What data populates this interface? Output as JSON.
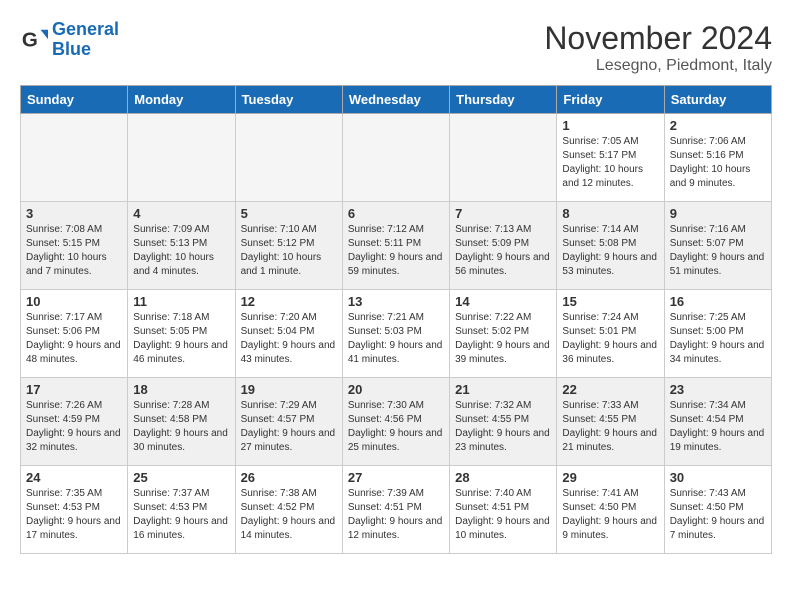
{
  "logo": {
    "line1": "General",
    "line2": "Blue"
  },
  "title": "November 2024",
  "subtitle": "Lesegno, Piedmont, Italy",
  "days_of_week": [
    "Sunday",
    "Monday",
    "Tuesday",
    "Wednesday",
    "Thursday",
    "Friday",
    "Saturday"
  ],
  "weeks": [
    [
      {
        "day": "",
        "info": ""
      },
      {
        "day": "",
        "info": ""
      },
      {
        "day": "",
        "info": ""
      },
      {
        "day": "",
        "info": ""
      },
      {
        "day": "",
        "info": ""
      },
      {
        "day": "1",
        "info": "Sunrise: 7:05 AM\nSunset: 5:17 PM\nDaylight: 10 hours and 12 minutes."
      },
      {
        "day": "2",
        "info": "Sunrise: 7:06 AM\nSunset: 5:16 PM\nDaylight: 10 hours and 9 minutes."
      }
    ],
    [
      {
        "day": "3",
        "info": "Sunrise: 7:08 AM\nSunset: 5:15 PM\nDaylight: 10 hours and 7 minutes."
      },
      {
        "day": "4",
        "info": "Sunrise: 7:09 AM\nSunset: 5:13 PM\nDaylight: 10 hours and 4 minutes."
      },
      {
        "day": "5",
        "info": "Sunrise: 7:10 AM\nSunset: 5:12 PM\nDaylight: 10 hours and 1 minute."
      },
      {
        "day": "6",
        "info": "Sunrise: 7:12 AM\nSunset: 5:11 PM\nDaylight: 9 hours and 59 minutes."
      },
      {
        "day": "7",
        "info": "Sunrise: 7:13 AM\nSunset: 5:09 PM\nDaylight: 9 hours and 56 minutes."
      },
      {
        "day": "8",
        "info": "Sunrise: 7:14 AM\nSunset: 5:08 PM\nDaylight: 9 hours and 53 minutes."
      },
      {
        "day": "9",
        "info": "Sunrise: 7:16 AM\nSunset: 5:07 PM\nDaylight: 9 hours and 51 minutes."
      }
    ],
    [
      {
        "day": "10",
        "info": "Sunrise: 7:17 AM\nSunset: 5:06 PM\nDaylight: 9 hours and 48 minutes."
      },
      {
        "day": "11",
        "info": "Sunrise: 7:18 AM\nSunset: 5:05 PM\nDaylight: 9 hours and 46 minutes."
      },
      {
        "day": "12",
        "info": "Sunrise: 7:20 AM\nSunset: 5:04 PM\nDaylight: 9 hours and 43 minutes."
      },
      {
        "day": "13",
        "info": "Sunrise: 7:21 AM\nSunset: 5:03 PM\nDaylight: 9 hours and 41 minutes."
      },
      {
        "day": "14",
        "info": "Sunrise: 7:22 AM\nSunset: 5:02 PM\nDaylight: 9 hours and 39 minutes."
      },
      {
        "day": "15",
        "info": "Sunrise: 7:24 AM\nSunset: 5:01 PM\nDaylight: 9 hours and 36 minutes."
      },
      {
        "day": "16",
        "info": "Sunrise: 7:25 AM\nSunset: 5:00 PM\nDaylight: 9 hours and 34 minutes."
      }
    ],
    [
      {
        "day": "17",
        "info": "Sunrise: 7:26 AM\nSunset: 4:59 PM\nDaylight: 9 hours and 32 minutes."
      },
      {
        "day": "18",
        "info": "Sunrise: 7:28 AM\nSunset: 4:58 PM\nDaylight: 9 hours and 30 minutes."
      },
      {
        "day": "19",
        "info": "Sunrise: 7:29 AM\nSunset: 4:57 PM\nDaylight: 9 hours and 27 minutes."
      },
      {
        "day": "20",
        "info": "Sunrise: 7:30 AM\nSunset: 4:56 PM\nDaylight: 9 hours and 25 minutes."
      },
      {
        "day": "21",
        "info": "Sunrise: 7:32 AM\nSunset: 4:55 PM\nDaylight: 9 hours and 23 minutes."
      },
      {
        "day": "22",
        "info": "Sunrise: 7:33 AM\nSunset: 4:55 PM\nDaylight: 9 hours and 21 minutes."
      },
      {
        "day": "23",
        "info": "Sunrise: 7:34 AM\nSunset: 4:54 PM\nDaylight: 9 hours and 19 minutes."
      }
    ],
    [
      {
        "day": "24",
        "info": "Sunrise: 7:35 AM\nSunset: 4:53 PM\nDaylight: 9 hours and 17 minutes."
      },
      {
        "day": "25",
        "info": "Sunrise: 7:37 AM\nSunset: 4:53 PM\nDaylight: 9 hours and 16 minutes."
      },
      {
        "day": "26",
        "info": "Sunrise: 7:38 AM\nSunset: 4:52 PM\nDaylight: 9 hours and 14 minutes."
      },
      {
        "day": "27",
        "info": "Sunrise: 7:39 AM\nSunset: 4:51 PM\nDaylight: 9 hours and 12 minutes."
      },
      {
        "day": "28",
        "info": "Sunrise: 7:40 AM\nSunset: 4:51 PM\nDaylight: 9 hours and 10 minutes."
      },
      {
        "day": "29",
        "info": "Sunrise: 7:41 AM\nSunset: 4:50 PM\nDaylight: 9 hours and 9 minutes."
      },
      {
        "day": "30",
        "info": "Sunrise: 7:43 AM\nSunset: 4:50 PM\nDaylight: 9 hours and 7 minutes."
      }
    ]
  ]
}
